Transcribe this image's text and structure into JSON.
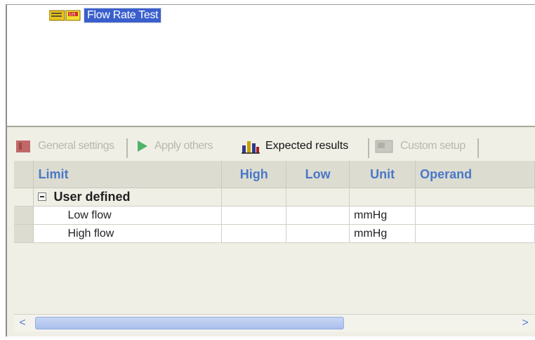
{
  "tree": {
    "item_label": "Flow Rate Test",
    "item_icon": "test-procedure-icon"
  },
  "tabs": [
    {
      "label": "General settings",
      "icon": "general-settings-icon",
      "active": false
    },
    {
      "label": "Apply others",
      "icon": "play-icon",
      "active": false
    },
    {
      "label": "Expected results",
      "icon": "chart-bars-icon",
      "active": true
    },
    {
      "label": "Custom setup",
      "icon": "custom-setup-icon",
      "active": false
    }
  ],
  "grid": {
    "columns": [
      "Limit",
      "High",
      "Low",
      "Unit",
      "Operand"
    ],
    "group_label": "User defined",
    "rows": [
      {
        "limit": "Low flow",
        "high": "",
        "low": "",
        "unit": "mmHg",
        "operand": ""
      },
      {
        "limit": "High flow",
        "high": "",
        "low": "",
        "unit": "mmHg",
        "operand": ""
      }
    ]
  },
  "scrollbar": {
    "left_arrow": "<",
    "right_arrow": ">"
  },
  "colors": {
    "selection": "#3a5fcd",
    "header_text": "#4a78c8",
    "panel_bg": "#f0efe6"
  }
}
